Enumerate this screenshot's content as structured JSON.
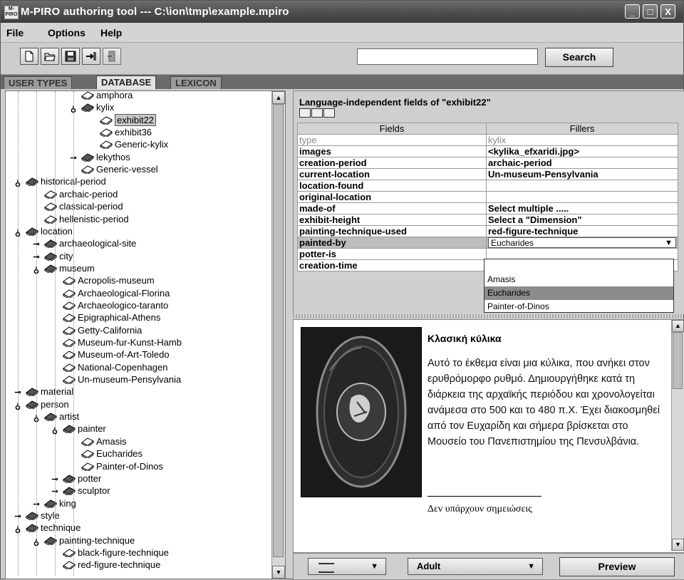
{
  "window": {
    "app_icon_text": "M-PIRO",
    "title": "M-PIRO authoring tool --- C:\\ion\\tmp\\example.mpiro",
    "minimize": "_",
    "maximize": "□",
    "close": "X"
  },
  "menu": {
    "file": "File",
    "options": "Options",
    "help": "Help"
  },
  "toolbar": {
    "search_value": "",
    "search_label": "Search",
    "icons": [
      "new-file-icon",
      "open-folder-icon",
      "save-icon",
      "import-icon",
      "exit-icon"
    ]
  },
  "tabs": [
    {
      "label": "USER TYPES",
      "active": false
    },
    {
      "label": "DATABASE",
      "active": true
    },
    {
      "label": "LEXICON",
      "active": false
    }
  ],
  "tree": [
    {
      "label": "amphora",
      "depth": 3,
      "handle": "",
      "selected": false
    },
    {
      "label": "kylix",
      "depth": 3,
      "handle": "open",
      "selected": false
    },
    {
      "label": "exhibit22",
      "depth": 4,
      "handle": "",
      "selected": true
    },
    {
      "label": "exhibit36",
      "depth": 4,
      "handle": "",
      "selected": false
    },
    {
      "label": "Generic-kylix",
      "depth": 4,
      "handle": "",
      "selected": false
    },
    {
      "label": "lekythos",
      "depth": 3,
      "handle": "closed",
      "selected": false
    },
    {
      "label": "Generic-vessel",
      "depth": 3,
      "handle": "",
      "selected": false
    },
    {
      "label": "historical-period",
      "depth": 0,
      "handle": "open",
      "selected": false
    },
    {
      "label": "archaic-period",
      "depth": 1,
      "handle": "",
      "selected": false
    },
    {
      "label": "classical-period",
      "depth": 1,
      "handle": "",
      "selected": false
    },
    {
      "label": "hellenistic-period",
      "depth": 1,
      "handle": "",
      "selected": false
    },
    {
      "label": "location",
      "depth": 0,
      "handle": "open",
      "selected": false
    },
    {
      "label": "archaeological-site",
      "depth": 1,
      "handle": "closed",
      "selected": false
    },
    {
      "label": "city",
      "depth": 1,
      "handle": "closed",
      "selected": false
    },
    {
      "label": "museum",
      "depth": 1,
      "handle": "open",
      "selected": false
    },
    {
      "label": "Acropolis-museum",
      "depth": 2,
      "handle": "",
      "selected": false
    },
    {
      "label": "Archaeological-Florina",
      "depth": 2,
      "handle": "",
      "selected": false
    },
    {
      "label": "Archaeologico-taranto",
      "depth": 2,
      "handle": "",
      "selected": false
    },
    {
      "label": "Epigraphical-Athens",
      "depth": 2,
      "handle": "",
      "selected": false
    },
    {
      "label": "Getty-California",
      "depth": 2,
      "handle": "",
      "selected": false
    },
    {
      "label": "Museum-fur-Kunst-Hamb",
      "depth": 2,
      "handle": "",
      "selected": false
    },
    {
      "label": "Museum-of-Art-Toledo",
      "depth": 2,
      "handle": "",
      "selected": false
    },
    {
      "label": "National-Copenhagen",
      "depth": 2,
      "handle": "",
      "selected": false
    },
    {
      "label": "Un-museum-Pensylvania",
      "depth": 2,
      "handle": "",
      "selected": false
    },
    {
      "label": "material",
      "depth": 0,
      "handle": "closed",
      "selected": false
    },
    {
      "label": "person",
      "depth": 0,
      "handle": "open",
      "selected": false
    },
    {
      "label": "artist",
      "depth": 1,
      "handle": "open",
      "selected": false
    },
    {
      "label": "painter",
      "depth": 2,
      "handle": "open",
      "selected": false
    },
    {
      "label": "Amasis",
      "depth": 3,
      "handle": "",
      "selected": false
    },
    {
      "label": "Eucharides",
      "depth": 3,
      "handle": "",
      "selected": false
    },
    {
      "label": "Painter-of-Dinos",
      "depth": 3,
      "handle": "",
      "selected": false
    },
    {
      "label": "potter",
      "depth": 2,
      "handle": "closed",
      "selected": false
    },
    {
      "label": "sculptor",
      "depth": 2,
      "handle": "closed",
      "selected": false
    },
    {
      "label": "king",
      "depth": 1,
      "handle": "closed",
      "selected": false
    },
    {
      "label": "style",
      "depth": 0,
      "handle": "closed",
      "selected": false
    },
    {
      "label": "technique",
      "depth": 0,
      "handle": "open",
      "selected": false
    },
    {
      "label": "painting-technique",
      "depth": 1,
      "handle": "open",
      "selected": false
    },
    {
      "label": "black-figure-technique",
      "depth": 2,
      "handle": "",
      "selected": false
    },
    {
      "label": "red-figure-technique",
      "depth": 2,
      "handle": "",
      "selected": false
    }
  ],
  "fields_panel": {
    "title": "Language-independent fields of \"exhibit22\"",
    "col_fields": "Fields",
    "col_fillers": "Fillers",
    "rows": [
      {
        "field": "type",
        "filler": "kylix",
        "dim": true
      },
      {
        "field": "images",
        "filler": "<kylika_efxaridi.jpg>"
      },
      {
        "field": "creation-period",
        "filler": "archaic-period"
      },
      {
        "field": "current-location",
        "filler": "Un-museum-Pensylvania"
      },
      {
        "field": "location-found",
        "filler": ""
      },
      {
        "field": "original-location",
        "filler": ""
      },
      {
        "field": "made-of",
        "filler": "Select multiple ....."
      },
      {
        "field": "exhibit-height",
        "filler": "Select a \"Dimension\""
      },
      {
        "field": "painting-technique-used",
        "filler": "red-figure-technique"
      },
      {
        "field": "painted-by",
        "filler": "Eucharides",
        "combo": true
      },
      {
        "field": "potter-is",
        "filler": ""
      },
      {
        "field": "creation-time",
        "filler": ""
      }
    ],
    "dropdown_options": [
      "",
      "Amasis",
      "Eucharides",
      "Painter-of-Dinos"
    ],
    "dropdown_selected": "Eucharides"
  },
  "preview": {
    "heading": "Κλασική κύλικα",
    "text": "Αυτό το έκθεμα είναι μια κύλικα, που ανήκει στον ερυθρόμορφο ρυθμό. Δημιουργήθηκε κατά τη διάρκεια της αρχαϊκής περιόδου και χρονολογείται ανάμεσα στο 500 και το 480 π.Χ. Έχει διακοσμηθεί από τον Ευχαρίδη και σήμερα βρίσκεται στο Μουσείο του Πανεπιστημίου της Πενσυλβάνια.",
    "note": "Δεν υπάρχουν σημειώσεις"
  },
  "bottom_bar": {
    "user_type": "Adult",
    "preview_label": "Preview"
  }
}
